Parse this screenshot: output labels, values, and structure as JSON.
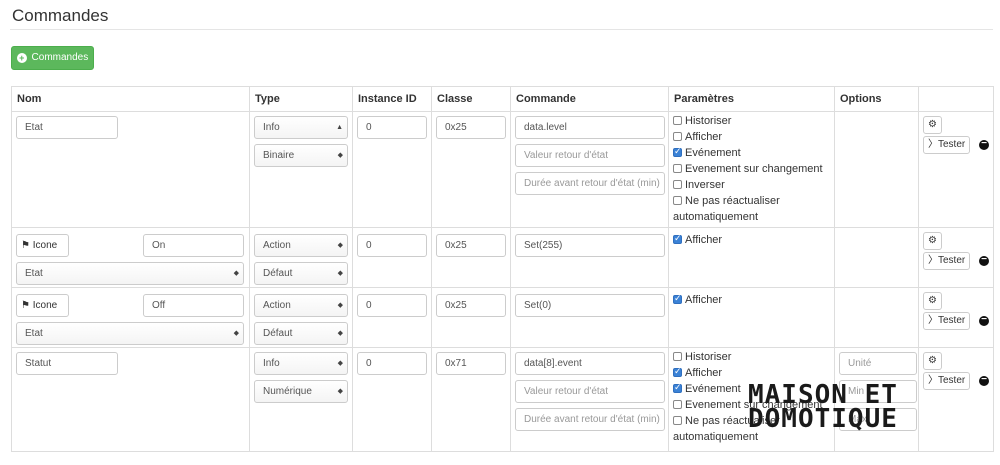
{
  "page": {
    "title": "Commandes"
  },
  "add_button": {
    "label": "Commandes"
  },
  "columns": [
    "Nom",
    "Type",
    "Instance ID",
    "Classe",
    "Commande",
    "Paramètres",
    "Options",
    ""
  ],
  "rows": [
    {
      "name": "Etat",
      "type": "Info",
      "subtype": "Binaire",
      "instance": "0",
      "classe": "0x25",
      "commande": "data.level",
      "retour_placeholder": "Valeur retour d'état",
      "duree_placeholder": "Durée avant retour d'état (min)",
      "params": [
        {
          "label": "Historiser",
          "checked": false
        },
        {
          "label": "Afficher",
          "checked": false
        },
        {
          "label": "Evénement",
          "checked": true
        },
        {
          "label": "Evenement sur changement",
          "checked": false
        },
        {
          "label": "Inverser",
          "checked": false
        },
        {
          "label": "Ne pas réactualiser",
          "checked": false
        }
      ],
      "params_extra": "automatiquement",
      "tester_label": "Tester"
    },
    {
      "icon_label": "Icone",
      "name": "On",
      "linked": "Etat",
      "type": "Action",
      "subtype": "Défaut",
      "instance": "0",
      "classe": "0x25",
      "commande": "Set(255)",
      "params": [
        {
          "label": "Afficher",
          "checked": true
        }
      ],
      "tester_label": "Tester"
    },
    {
      "icon_label": "Icone",
      "name": "Off",
      "linked": "Etat",
      "type": "Action",
      "subtype": "Défaut",
      "instance": "0",
      "classe": "0x25",
      "commande": "Set(0)",
      "params": [
        {
          "label": "Afficher",
          "checked": true
        }
      ],
      "tester_label": "Tester"
    },
    {
      "name": "Statut",
      "type": "Info",
      "subtype": "Numérique",
      "instance": "0",
      "classe": "0x71",
      "commande": "data[8].event",
      "retour_placeholder": "Valeur retour d'état",
      "duree_placeholder": "Durée avant retour d'état (min)",
      "params": [
        {
          "label": "Historiser",
          "checked": false
        },
        {
          "label": "Afficher",
          "checked": true
        },
        {
          "label": "Evénement",
          "checked": true
        },
        {
          "label": "Evenement sur changement",
          "checked": false
        },
        {
          "label": "Ne pas réactualiser",
          "checked": false
        }
      ],
      "params_extra": "automatiquement",
      "unit_placeholder": "Unité",
      "min_placeholder": "Min",
      "max_placeholder": "Max",
      "tester_label": "Tester"
    }
  ],
  "watermark": {
    "line1": "MAISON ET",
    "line2": "DOMOTIQUE"
  },
  "icons": {
    "add": "plus-circle-icon",
    "config": "gears-icon",
    "tester": "rss-icon",
    "remove": "minus-circle-icon",
    "flag": "flag-icon",
    "select": "updown-arrows-icon"
  }
}
